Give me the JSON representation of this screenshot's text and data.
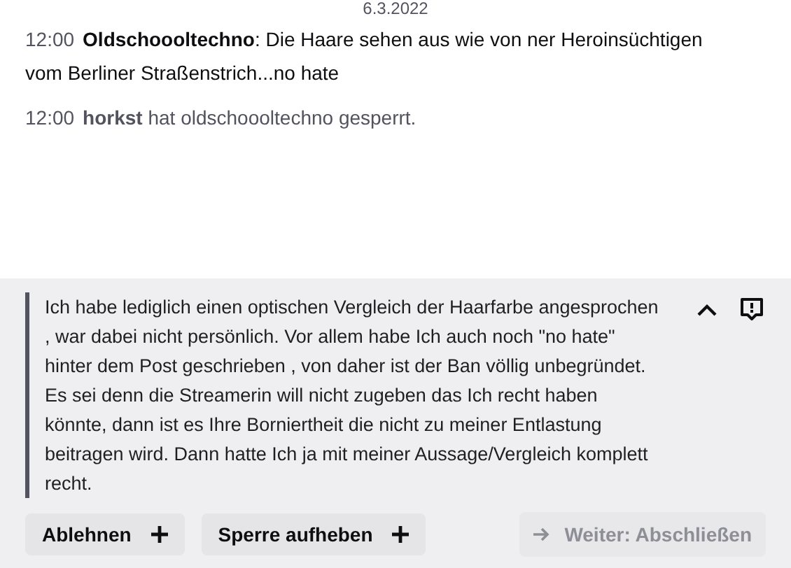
{
  "chat": {
    "date": "6.3.2022",
    "messages": [
      {
        "kind": "message",
        "time": "12:00",
        "user": "Oldschoooltechno",
        "text": ": Die Haare sehen aus wie von ner Heroinsüchtigen vom Berliner Straßenstrich...no hate"
      },
      {
        "kind": "notice",
        "time": "12:00",
        "user": "horkst",
        "text": "hat oldschoooltechno gesperrt."
      }
    ]
  },
  "appeal": {
    "text": "Ich habe lediglich einen optischen Vergleich der Haarfarbe angesprochen , war dabei nicht persönlich. Vor allem habe Ich auch noch \"no hate\" hinter dem Post geschrieben , von daher ist der Ban völlig unbegründet. Es sei denn die Streamerin will nicht zugeben das Ich recht haben könnte, dann ist es Ihre Borniertheit die nicht zu meiner Entlastung beitragen wird. Dann hatte Ich ja mit meiner Aussage/Vergleich komplett recht.",
    "expanded": true
  },
  "actions": [
    {
      "label": "Ablehnen"
    },
    {
      "label": "Sperre aufheben"
    }
  ],
  "next_button": {
    "label": "Weiter: Abschließen",
    "disabled": true
  }
}
